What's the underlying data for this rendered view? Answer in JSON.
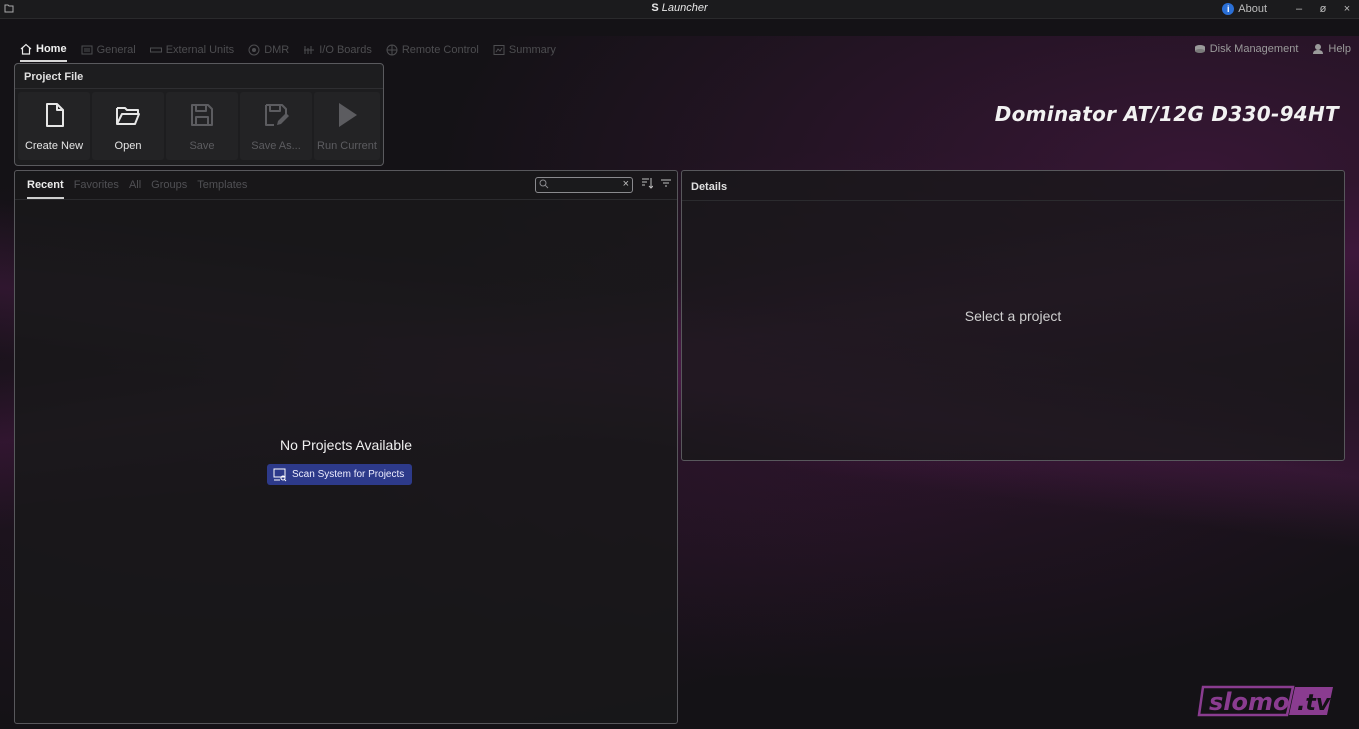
{
  "window": {
    "title": "Launcher",
    "about_label": "About",
    "minimize": "–",
    "restore": "ø",
    "close": "×"
  },
  "nav": {
    "tabs": [
      {
        "label": "Home",
        "icon": "home-icon",
        "active": true
      },
      {
        "label": "General",
        "icon": "general-icon"
      },
      {
        "label": "External Units",
        "icon": "external-units-icon"
      },
      {
        "label": "DMR",
        "icon": "dmr-icon"
      },
      {
        "label": "I/O Boards",
        "icon": "io-boards-icon"
      },
      {
        "label": "Remote Control",
        "icon": "remote-control-icon"
      },
      {
        "label": "Summary",
        "icon": "summary-icon"
      }
    ],
    "disk_management": "Disk Management",
    "help": "Help"
  },
  "project_file": {
    "header": "Project File",
    "buttons": [
      {
        "label": "Create New",
        "icon": "new-file-icon",
        "enabled": true
      },
      {
        "label": "Open",
        "icon": "folder-open-icon",
        "enabled": true
      },
      {
        "label": "Save",
        "icon": "save-icon",
        "enabled": false
      },
      {
        "label": "Save As...",
        "icon": "save-as-icon",
        "enabled": false
      },
      {
        "label": "Run Current",
        "icon": "play-icon",
        "enabled": false
      }
    ]
  },
  "device_name": "Dominator AT/12G D330-94HT",
  "projects": {
    "tabs": [
      "Recent",
      "Favorites",
      "All",
      "Groups",
      "Templates"
    ],
    "active_tab": "Recent",
    "search_placeholder": "",
    "empty_message": "No Projects Available",
    "scan_button": "Scan System for Projects"
  },
  "details": {
    "header": "Details",
    "placeholder": "Select a project"
  },
  "brand": "slomo.tv",
  "colors": {
    "accent_button": "#2d3a8a",
    "about_info": "#2a6fd6",
    "background_glow": "#78206e"
  }
}
